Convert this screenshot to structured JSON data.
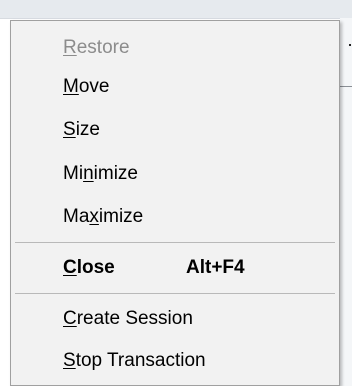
{
  "menu": {
    "items": [
      {
        "pre": "",
        "u": "R",
        "post": "estore",
        "enabled": false
      },
      {
        "pre": "",
        "u": "M",
        "post": "ove",
        "enabled": true
      },
      {
        "pre": "",
        "u": "S",
        "post": "ize",
        "enabled": true
      },
      {
        "pre": "Mi",
        "u": "n",
        "post": "imize",
        "enabled": true
      },
      {
        "pre": "Ma",
        "u": "x",
        "post": "imize",
        "enabled": true
      },
      {
        "pre": "",
        "u": "C",
        "post": "lose",
        "shortcut": "Alt+F4",
        "enabled": true,
        "bold": true
      },
      {
        "pre": "",
        "u": "C",
        "post": "reate Session",
        "enabled": true
      },
      {
        "pre": "",
        "u": "S",
        "post": "top Transaction",
        "enabled": true
      }
    ]
  }
}
